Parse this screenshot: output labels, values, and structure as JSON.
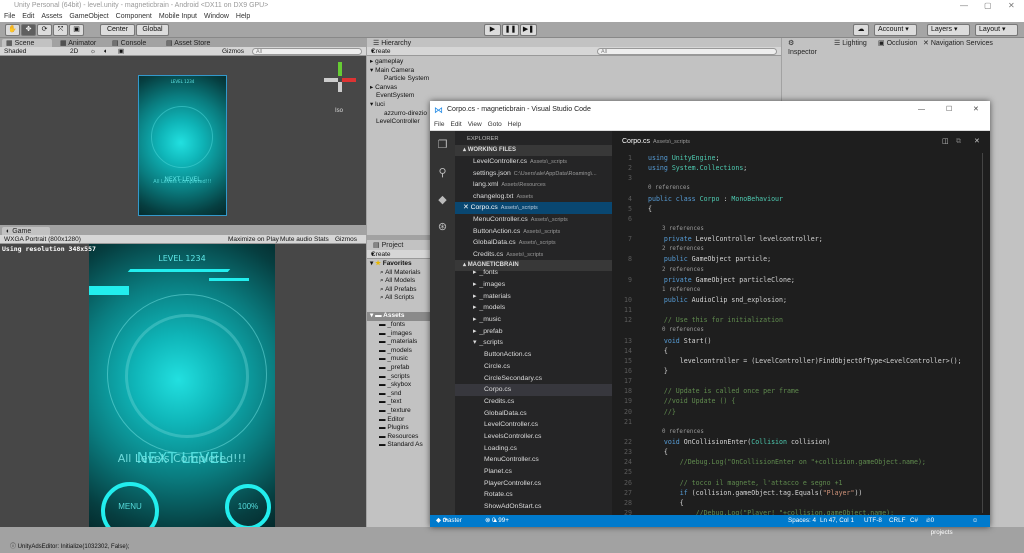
{
  "unity": {
    "title": "Unity Personal (64bit) - level.unity - magneticbrain - Android <DX11 on DX9 GPU>",
    "menu": [
      "File",
      "Edit",
      "Assets",
      "GameObject",
      "Component",
      "Mobile Input",
      "Window",
      "Help"
    ],
    "toolbar": {
      "center": "Center",
      "global": "Global",
      "account": "Account",
      "layers": "Layers",
      "layout": "Layout"
    },
    "scene": {
      "tabs": [
        "Scene",
        "Animator",
        "Console",
        "Asset Store"
      ],
      "shading": "Shaded",
      "mode2d": "2D",
      "gizmos": "Gizmos",
      "search": "All",
      "iso": "Iso"
    },
    "game": {
      "tab": "Game",
      "resolution": "WXGA Portrait (800x1280)",
      "maximize": "Maximize on Play",
      "mute": "Mute audio",
      "stats": "Stats",
      "gizmos": "Gizmos",
      "info": "Using resolution 348x557",
      "level": "LEVEL 1234",
      "next": "NEXT LEVEL",
      "completed": "All Levels Completed!!!",
      "menu": "MENU",
      "percent": "100%"
    },
    "hierarchy": {
      "tab": "Hierarchy",
      "create": "Create",
      "search": "All",
      "items": [
        "gameplay",
        "Main Camera",
        "Particle System",
        "Canvas",
        "EventSystem",
        "luci",
        "azzurro-direzio",
        "LevelController"
      ]
    },
    "project": {
      "tab": "Project",
      "create": "Create",
      "favorites": "Favorites",
      "fav_items": [
        "All Materials",
        "All Models",
        "All Prefabs",
        "All Scripts"
      ],
      "assets": "Assets",
      "folders": [
        "_fonts",
        "_images",
        "_materials",
        "_models",
        "_music",
        "_prefab",
        "_scripts",
        "_skybox",
        "_snd",
        "_text",
        "_texture",
        "Editor",
        "Plugins",
        "Resources",
        "Standard As"
      ]
    },
    "inspector": {
      "tabs": [
        "Inspector",
        "Lighting",
        "Occlusion",
        "Navigation",
        "Services"
      ]
    },
    "status": "UnityAdsEditor: Initialize(1032302, False);"
  },
  "vscode": {
    "title": "Corpo.cs - magneticbrain - Visual Studio Code",
    "menu": [
      "File",
      "Edit",
      "View",
      "Goto",
      "Help"
    ],
    "explorer": "EXPLORER",
    "working_files_header": "WORKING FILES",
    "working_files": [
      {
        "name": "LevelController.cs",
        "path": "Assets\\_scripts"
      },
      {
        "name": "settings.json",
        "path": "C:\\Users\\ale\\AppData\\Roaming\\..."
      },
      {
        "name": "lang.xml",
        "path": "Assets\\Resources"
      },
      {
        "name": "changelog.txt",
        "path": "Assets"
      },
      {
        "name": "Corpo.cs",
        "path": "Assets\\_scripts",
        "selected": true
      },
      {
        "name": "MenuController.cs",
        "path": "Assets\\_scripts"
      },
      {
        "name": "ButtonAction.cs",
        "path": "Assets\\_scripts"
      },
      {
        "name": "GlobalData.cs",
        "path": "Assets\\_scripts"
      },
      {
        "name": "Credits.cs",
        "path": "Assets\\_scripts"
      }
    ],
    "project_header": "MAGNETICBRAIN",
    "tree": [
      {
        "name": "_fonts",
        "depth": 1,
        "arrow": "▸"
      },
      {
        "name": "_images",
        "depth": 1,
        "arrow": "▸"
      },
      {
        "name": "_materials",
        "depth": 1,
        "arrow": "▸"
      },
      {
        "name": "_models",
        "depth": 1,
        "arrow": "▸"
      },
      {
        "name": "_music",
        "depth": 1,
        "arrow": "▸"
      },
      {
        "name": "_prefab",
        "depth": 1,
        "arrow": "▸"
      },
      {
        "name": "_scripts",
        "depth": 1,
        "arrow": "▾"
      },
      {
        "name": "ButtonAction.cs",
        "depth": 2
      },
      {
        "name": "Circle.cs",
        "depth": 2
      },
      {
        "name": "CircleSecondary.cs",
        "depth": 2
      },
      {
        "name": "Corpo.cs",
        "depth": 2,
        "selected": true
      },
      {
        "name": "Credits.cs",
        "depth": 2
      },
      {
        "name": "GlobalData.cs",
        "depth": 2
      },
      {
        "name": "LevelController.cs",
        "depth": 2
      },
      {
        "name": "LevelsController.cs",
        "depth": 2
      },
      {
        "name": "Loading.cs",
        "depth": 2
      },
      {
        "name": "MenuController.cs",
        "depth": 2
      },
      {
        "name": "Planet.cs",
        "depth": 2
      },
      {
        "name": "PlayerController.cs",
        "depth": 2
      },
      {
        "name": "Rotate.cs",
        "depth": 2
      },
      {
        "name": "ShowAdOnStart.cs",
        "depth": 2
      }
    ],
    "editor_tab": {
      "name": "Corpo.cs",
      "path": "Assets\\_scripts"
    },
    "code": [
      {
        "n": "1",
        "tokens": [
          [
            "using ",
            "k"
          ],
          [
            "UnityEngine",
            "t"
          ],
          [
            ";",
            "p"
          ]
        ]
      },
      {
        "n": "2",
        "tokens": [
          [
            "using ",
            "k"
          ],
          [
            "System.Collections",
            "t"
          ],
          [
            ";",
            "p"
          ]
        ]
      },
      {
        "n": "3",
        "tokens": []
      },
      {
        "ref": "0 references"
      },
      {
        "n": "4",
        "tokens": [
          [
            "public class ",
            "k"
          ],
          [
            "Corpo",
            "t"
          ],
          [
            " : ",
            "p"
          ],
          [
            "MonoBehaviour",
            "t"
          ]
        ]
      },
      {
        "n": "5",
        "tokens": [
          [
            "{",
            "p"
          ]
        ]
      },
      {
        "n": "6",
        "tokens": []
      },
      {
        "ref": "    3 references"
      },
      {
        "n": "7",
        "tokens": [
          [
            "    private ",
            "k"
          ],
          [
            "LevelController levelcontroller;",
            "p"
          ]
        ]
      },
      {
        "ref": "    2 references"
      },
      {
        "n": "8",
        "tokens": [
          [
            "    public ",
            "k"
          ],
          [
            "GameObject particle;",
            "p"
          ]
        ]
      },
      {
        "ref": "    2 references"
      },
      {
        "n": "9",
        "tokens": [
          [
            "    private ",
            "k"
          ],
          [
            "GameObject particleClone;",
            "p"
          ]
        ]
      },
      {
        "ref": "    1 reference"
      },
      {
        "n": "10",
        "tokens": [
          [
            "    public ",
            "k"
          ],
          [
            "AudioClip snd_explosion;",
            "p"
          ]
        ]
      },
      {
        "n": "11",
        "tokens": []
      },
      {
        "n": "12",
        "tokens": [
          [
            "    // Use this for initialization",
            "c"
          ]
        ]
      },
      {
        "ref": "    0 references"
      },
      {
        "n": "13",
        "tokens": [
          [
            "    void ",
            "k"
          ],
          [
            "Start()",
            "p"
          ]
        ]
      },
      {
        "n": "14",
        "tokens": [
          [
            "    {",
            "p"
          ]
        ]
      },
      {
        "n": "15",
        "tokens": [
          [
            "        levelcontroller = (LevelController)FindObjectOfType<LevelController>();",
            "p"
          ]
        ]
      },
      {
        "n": "16",
        "tokens": [
          [
            "    }",
            "p"
          ]
        ]
      },
      {
        "n": "17",
        "tokens": []
      },
      {
        "n": "18",
        "tokens": [
          [
            "    // Update is called once per frame",
            "c"
          ]
        ]
      },
      {
        "n": "19",
        "tokens": [
          [
            "    //void Update () {",
            "c"
          ]
        ]
      },
      {
        "n": "20",
        "tokens": [
          [
            "    //}",
            "c"
          ]
        ]
      },
      {
        "n": "21",
        "tokens": []
      },
      {
        "ref": "    0 references"
      },
      {
        "n": "22",
        "tokens": [
          [
            "    void ",
            "k"
          ],
          [
            "OnCollisionEnter(",
            "p"
          ],
          [
            "Collision",
            "t"
          ],
          [
            " collision)",
            "p"
          ]
        ]
      },
      {
        "n": "23",
        "tokens": [
          [
            "    {",
            "p"
          ]
        ]
      },
      {
        "n": "24",
        "tokens": [
          [
            "        //Debug.Log(\"OnCollisionEnter on \"+collision.gameObject.name);",
            "c"
          ]
        ]
      },
      {
        "n": "25",
        "tokens": []
      },
      {
        "n": "26",
        "tokens": [
          [
            "        // tocco il magnete, l'attacco e segno +1",
            "c"
          ]
        ]
      },
      {
        "n": "27",
        "tokens": [
          [
            "        if ",
            "k"
          ],
          [
            "(collision.gameObject.tag.Equals(",
            "p"
          ],
          [
            "\"Player\"",
            "s"
          ],
          [
            "))",
            "p"
          ]
        ]
      },
      {
        "n": "28",
        "tokens": [
          [
            "        {",
            "p"
          ]
        ]
      },
      {
        "n": "29",
        "tokens": [
          [
            "            //Debug.Log(\"Player! \"+collision.gameObject.name);",
            "c"
          ]
        ]
      }
    ],
    "status": {
      "branch": "master",
      "errors": "0",
      "warnings": "99+",
      "spaces": "Spaces: 4",
      "position": "Ln 47, Col 1",
      "encoding": "UTF-8",
      "eol": "CRLF",
      "language": "C#",
      "projects": "0 projects"
    },
    "colors": {
      "accent": "#007acc",
      "selection": "#094771"
    }
  }
}
